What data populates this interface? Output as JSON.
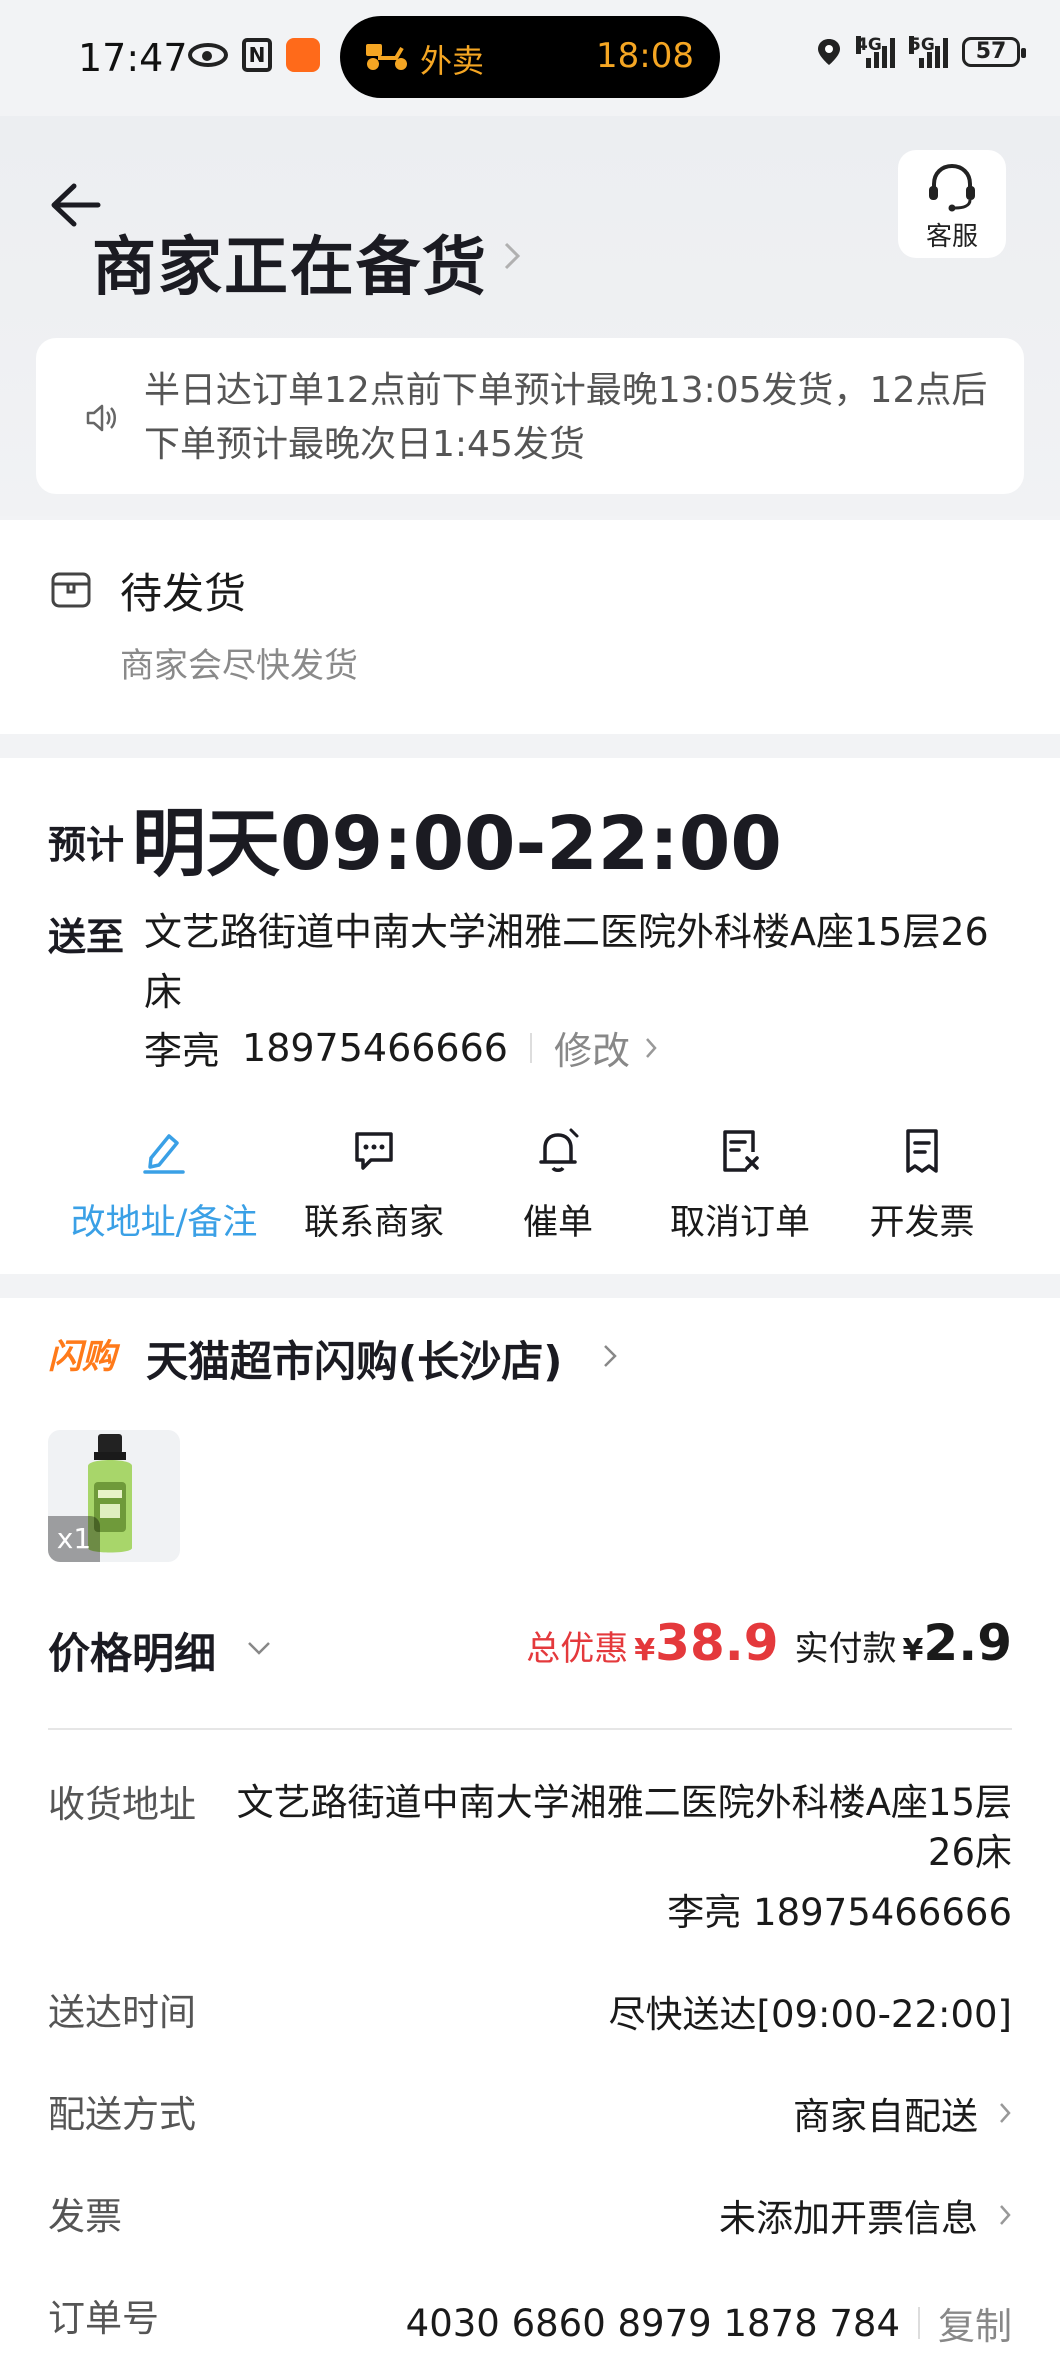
{
  "status_bar": {
    "time": "17:47",
    "island_label": "外卖",
    "island_time": "18:08",
    "network_1": "4G",
    "network_2": "5G",
    "battery": "57"
  },
  "header": {
    "title": "商家正在备货",
    "service_label": "客服",
    "notice": "半日达订单12点前下单预计最晚13:05发货，12点后下单预计最晚次日1:45发货"
  },
  "status": {
    "title": "待发货",
    "subtitle": "商家会尽快发货"
  },
  "delivery": {
    "eta_prefix": "预计",
    "eta_time": "明天09:00-22:00",
    "send_to_label": "送至",
    "address": "文艺路街道中南大学湘雅二医院外科楼A座15层26床",
    "contact_name": "李亮",
    "contact_phone": "18975466666",
    "edit_label": "修改",
    "actions": [
      {
        "label": "改地址/备注",
        "icon": "edit-icon"
      },
      {
        "label": "联系商家",
        "icon": "chat-icon"
      },
      {
        "label": "催单",
        "icon": "bell-icon"
      },
      {
        "label": "取消订单",
        "icon": "cancel-doc-icon"
      },
      {
        "label": "开发票",
        "icon": "invoice-icon"
      }
    ]
  },
  "shop": {
    "logo_text": "闪购",
    "name": "天猫超市闪购(长沙店)",
    "product_qty": "x1"
  },
  "price": {
    "title": "价格明细",
    "discount_label": "总优惠",
    "currency": "¥",
    "discount_amount": "38.9",
    "paid_label": "实付款",
    "paid_amount": "2.9"
  },
  "details": {
    "address_label": "收货地址",
    "address_value": "文艺路街道中南大学湘雅二医院外科楼A座15层26床",
    "address_contact": "李亮 18975466666",
    "time_label": "送达时间",
    "time_value": "尽快送达[09:00-22:00]",
    "method_label": "配送方式",
    "method_value": "商家自配送",
    "invoice_label": "发票",
    "invoice_value": "未添加开票信息",
    "order_label": "订单号",
    "order_value": "4030 6860 8979 1878 784",
    "copy_label": "复制"
  },
  "colors": {
    "accent_blue": "#3aa0e6",
    "discount_red": "#e4393c",
    "island_orange": "#f5a623"
  }
}
